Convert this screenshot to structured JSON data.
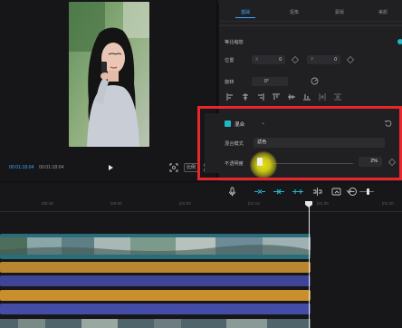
{
  "player": {
    "current_time": "00:01:18:04",
    "total_time": "00:01:18:04",
    "ratio_label": "比例"
  },
  "inspector": {
    "tabs": [
      "基础",
      "抠像",
      "蒙版",
      "美颜"
    ],
    "uniform_scale_label": "等比缩放",
    "position_label": "位置",
    "position_x_axis": "X",
    "position_x_value": "0",
    "position_y_axis": "Y",
    "position_y_value": "0",
    "rotation_label": "旋转",
    "rotation_value": "0°"
  },
  "blend": {
    "title": "混合",
    "chevron": "⌄",
    "mode_label": "混合模式",
    "mode_value": "滤色",
    "opacity_label": "不透明度",
    "opacity_value": "2%",
    "opacity_fraction": 0.02
  },
  "timeline": {
    "ruler_ticks": [
      "|00:40",
      "|00:50",
      "|01:00",
      "|01:10",
      "|01:20",
      "|01:30"
    ]
  },
  "colors": {
    "accent": "#3aa7ff",
    "teal": "#1fb8c9",
    "highlight": "#e8262c",
    "cursor_glow": "#e5e018"
  },
  "icons": [
    "play-icon",
    "fit-icon",
    "fullscreen-icon",
    "keyframe-icon",
    "rotate-icon",
    "reset-icon",
    "mic-icon",
    "link-icon",
    "split-icon",
    "zoom-out-icon",
    "zoom-slider-icon"
  ]
}
